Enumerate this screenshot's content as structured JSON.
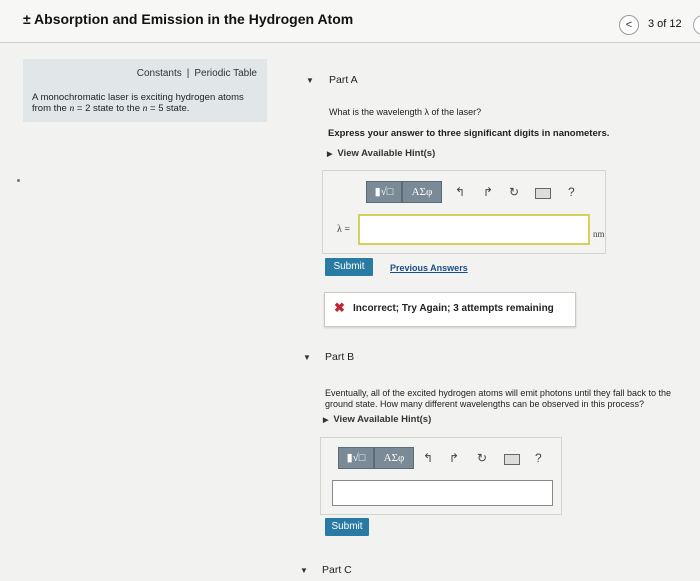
{
  "header": {
    "title": "± Absorption and Emission in the Hydrogen Atom",
    "prev_icon": "chevron-left-icon",
    "prev_glyph": "<",
    "page_count": "3 of 12"
  },
  "sidebar": {
    "constants_label": "Constants",
    "separator": "|",
    "periodic_label": "Periodic Table",
    "problem_line1": "A monochromatic laser is exciting hydrogen atoms",
    "problem_pre": "from the ",
    "n_symbol": "n",
    "n_equals_2": " = 2 state to the ",
    "n_symbol2": "n",
    "n_equals_5": " = 5 state."
  },
  "partA": {
    "title": "Part A",
    "question": "What is the wavelength λ of the laser?",
    "instruction": "Express your answer to three significant digits in nanometers.",
    "hint_label": "View Available Hint(s)",
    "toolbar": {
      "templates_glyph": "▮√□",
      "greek_glyph": "ΑΣφ",
      "undo_glyph": "↰",
      "redo_glyph": "↱",
      "reset_glyph": "↻",
      "help_glyph": "?"
    },
    "input_label": "λ =",
    "input_value": "",
    "unit": "nm",
    "submit_label": "Submit",
    "previous_answers_label": "Previous Answers",
    "feedback_icon": "✖",
    "feedback_text": "Incorrect; Try Again; 3 attempts remaining"
  },
  "partB": {
    "title": "Part B",
    "question_line1": "Eventually, all of the excited hydrogen atoms will emit photons until they fall back to the",
    "question_line2": "ground state. How many different wavelengths can be observed in this process?",
    "hint_label": "View Available Hint(s)",
    "toolbar": {
      "templates_glyph": "▮√□",
      "greek_glyph": "ΑΣφ",
      "undo_glyph": "↰",
      "redo_glyph": "↱",
      "reset_glyph": "↻",
      "help_glyph": "?"
    },
    "input_value": "",
    "submit_label": "Submit"
  },
  "partC": {
    "title": "Part C"
  },
  "colors": {
    "accent": "#2a7ba4",
    "input_focus": "#d7d15b",
    "error": "#c0262e",
    "sidebar_bg": "#e1e6e8"
  }
}
